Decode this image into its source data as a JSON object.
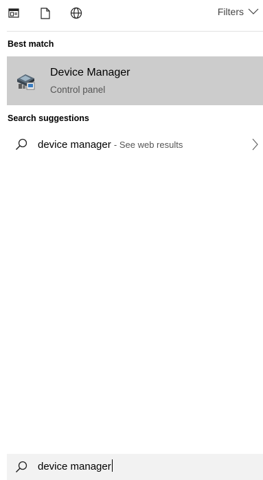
{
  "toolbar": {
    "icons": [
      "apps-icon",
      "document-icon",
      "web-icon"
    ],
    "filters_label": "Filters"
  },
  "best_match": {
    "heading": "Best match",
    "title": "Device Manager",
    "subtitle": "Control panel",
    "icon": "device-manager-icon"
  },
  "suggestions": {
    "heading": "Search suggestions",
    "items": [
      {
        "query": "device manager",
        "hint": "- See web results"
      }
    ]
  },
  "search": {
    "value": "device manager"
  }
}
